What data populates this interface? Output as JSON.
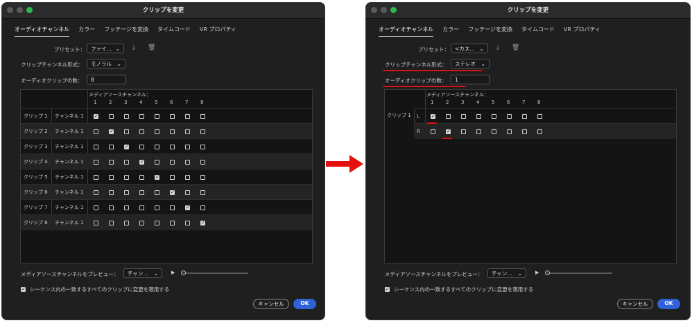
{
  "left": {
    "title": "クリップを変更",
    "tabs": [
      "オーディオチャンネル",
      "カラー",
      "フッテージを変換",
      "タイムコード",
      "VR プロパティ"
    ],
    "preset_label": "プリセット：",
    "preset_value": "ファイ…",
    "format_label": "クリップチャンネル形式：",
    "format_value": "モノラル",
    "count_label": "オーディオクリップの数：",
    "count_value": "8",
    "media_header": "メディアソースチャンネル：",
    "channel_numbers": [
      "1",
      "2",
      "3",
      "4",
      "5",
      "6",
      "7",
      "8"
    ],
    "rows": [
      {
        "clip": "クリップ 1",
        "channel": "チャンネル 1",
        "checked": 1
      },
      {
        "clip": "クリップ 2",
        "channel": "チャンネル 1",
        "checked": 2
      },
      {
        "clip": "クリップ 3",
        "channel": "チャンネル 1",
        "checked": 3
      },
      {
        "clip": "クリップ 4",
        "channel": "チャンネル 1",
        "checked": 4
      },
      {
        "clip": "クリップ 5",
        "channel": "チャンネル 1",
        "checked": 5
      },
      {
        "clip": "クリップ 6",
        "channel": "チャンネル 1",
        "checked": 6
      },
      {
        "clip": "クリップ 7",
        "channel": "チャンネル 1",
        "checked": 7
      },
      {
        "clip": "クリップ 8",
        "channel": "チャンネル 1",
        "checked": 8
      }
    ],
    "preview_label": "メディアソースチャンネルをプレビュー：",
    "preview_value": "チャン…",
    "apply_label": "シーケンス内の一致するすべてのクリップに変更を適用する",
    "cancel": "キャンセル",
    "ok": "OK"
  },
  "right": {
    "title": "クリップを変更",
    "tabs": [
      "オーディオチャンネル",
      "カラー",
      "フッテージを変換",
      "タイムコード",
      "VR プロパティ"
    ],
    "preset_label": "プリセット：",
    "preset_value": "<カス…",
    "format_label": "クリップチャンネル形式：",
    "format_value": "ステレオ",
    "count_label": "オーディオクリップの数：",
    "count_value": "1",
    "media_header": "メディアソースチャンネル：",
    "channel_numbers": [
      "1",
      "2",
      "3",
      "4",
      "5",
      "6",
      "7",
      "8"
    ],
    "clip": "クリップ 1",
    "rows": [
      {
        "channel": "L",
        "checked": 1
      },
      {
        "channel": "R",
        "checked": 2
      }
    ],
    "preview_label": "メディアソースチャンネルをプレビュー：",
    "preview_value": "チャン…",
    "apply_label": "シーケンス内の一致するすべてのクリップに変更を適用する",
    "cancel": "キャンセル",
    "ok": "OK"
  },
  "colors": {
    "accent": "#2f62d6",
    "highlight": "#e01010"
  }
}
